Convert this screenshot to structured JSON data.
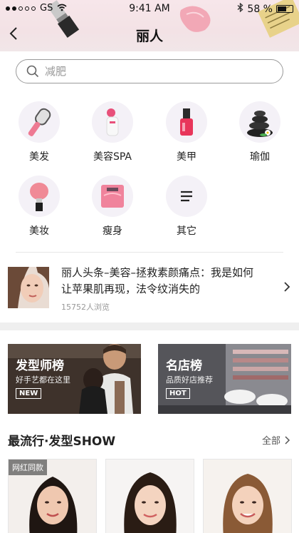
{
  "status_bar": {
    "carrier": "GS",
    "time": "9:41 AM",
    "battery_text": "58 %",
    "battery_level": 0.58
  },
  "nav": {
    "title": "丽人"
  },
  "search": {
    "placeholder": "减肥"
  },
  "categories": [
    {
      "label": "美发",
      "icon": "hairbrush-icon"
    },
    {
      "label": "美容SPA",
      "icon": "facial-steamer-icon"
    },
    {
      "label": "美甲",
      "icon": "nail-polish-icon"
    },
    {
      "label": "瑜伽",
      "icon": "spa-stones-icon"
    },
    {
      "label": "美妆",
      "icon": "makeup-brush-icon"
    },
    {
      "label": "瘦身",
      "icon": "scale-icon"
    },
    {
      "label": "其它",
      "icon": "menu-lines-icon"
    }
  ],
  "headline": {
    "text": "丽人头条–美容–拯救素颜痛点：我是如何让苹果肌再现，法令纹消失的",
    "views": "15752人浏览"
  },
  "banners": [
    {
      "title": "发型师榜",
      "subtitle": "好手艺都在这里",
      "tag": "NEW"
    },
    {
      "title": "名店榜",
      "subtitle": "品质好店推荐",
      "tag": "HOT"
    }
  ],
  "section": {
    "title": "最流行·发型SHOW",
    "more_label": "全部"
  },
  "cards": [
    {
      "badge": "网红同款"
    },
    {
      "badge": ""
    },
    {
      "badge": ""
    }
  ],
  "colors": {
    "header_bg": "#f3e2e5",
    "icon_circle": "#f4f1f7",
    "nail_polish": "#e8355a",
    "brush_pink": "#f08a96"
  }
}
